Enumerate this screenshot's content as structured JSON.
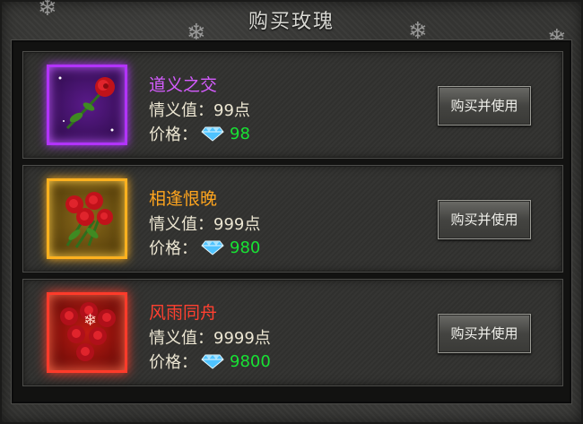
{
  "dialog": {
    "title": "购买玫瑰"
  },
  "colors": {
    "purple": "#c85cff",
    "gold": "#ffb11e",
    "red": "#ff3b2a",
    "price_green": "#18e234"
  },
  "items": [
    {
      "name": "道义之交",
      "name_color": "#d55cff",
      "info": "情义值：99点",
      "price_label": "价格：",
      "currency_icon": "diamond-icon",
      "price": "98",
      "button": "购买并使用"
    },
    {
      "name": "相逢恨晚",
      "name_color": "#ffa51e",
      "info": "情义值：999点",
      "price_label": "价格：",
      "currency_icon": "diamond-icon",
      "price": "980",
      "button": "购买并使用"
    },
    {
      "name": "风雨同舟",
      "name_color": "#ff4030",
      "info": "情义值：9999点",
      "price_label": "价格：",
      "currency_icon": "diamond-icon",
      "price": "9800",
      "button": "购买并使用"
    }
  ]
}
